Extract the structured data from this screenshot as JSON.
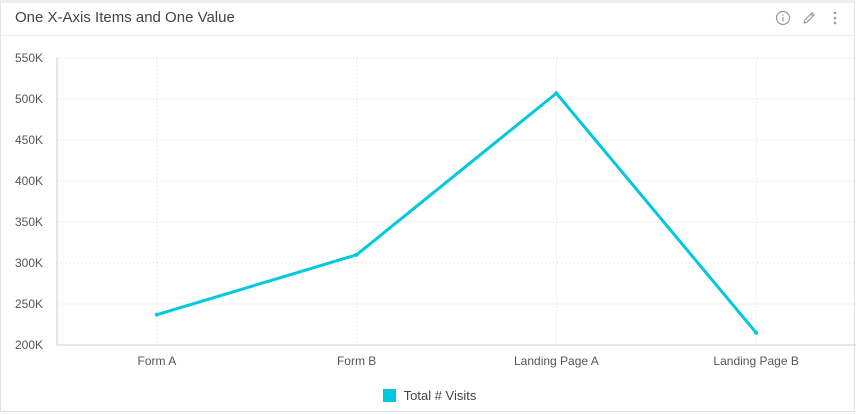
{
  "widget": {
    "title": "One X-Axis Items and One Value",
    "icons": [
      "info-icon",
      "edit-pencil-icon",
      "more-vertical-icon"
    ]
  },
  "colors": {
    "series": "#00c8e0",
    "grid": "#d9d9d9",
    "axis": "#cccccc"
  },
  "chart_data": {
    "type": "line",
    "title": "One X-Axis Items and One Value",
    "categories": [
      "Form A",
      "Form B",
      "Landing Page A",
      "Landing Page B"
    ],
    "series": [
      {
        "name": "Total # Visits",
        "values": [
          237000,
          310000,
          507000,
          215000
        ]
      }
    ],
    "ylim": [
      200000,
      550000
    ],
    "y_ticks": [
      200000,
      250000,
      300000,
      350000,
      400000,
      450000,
      500000,
      550000
    ],
    "y_tick_labels": [
      "200K",
      "250K",
      "300K",
      "350K",
      "400K",
      "450K",
      "500K",
      "550K"
    ],
    "grid": true,
    "legend_position": "bottom-center"
  }
}
